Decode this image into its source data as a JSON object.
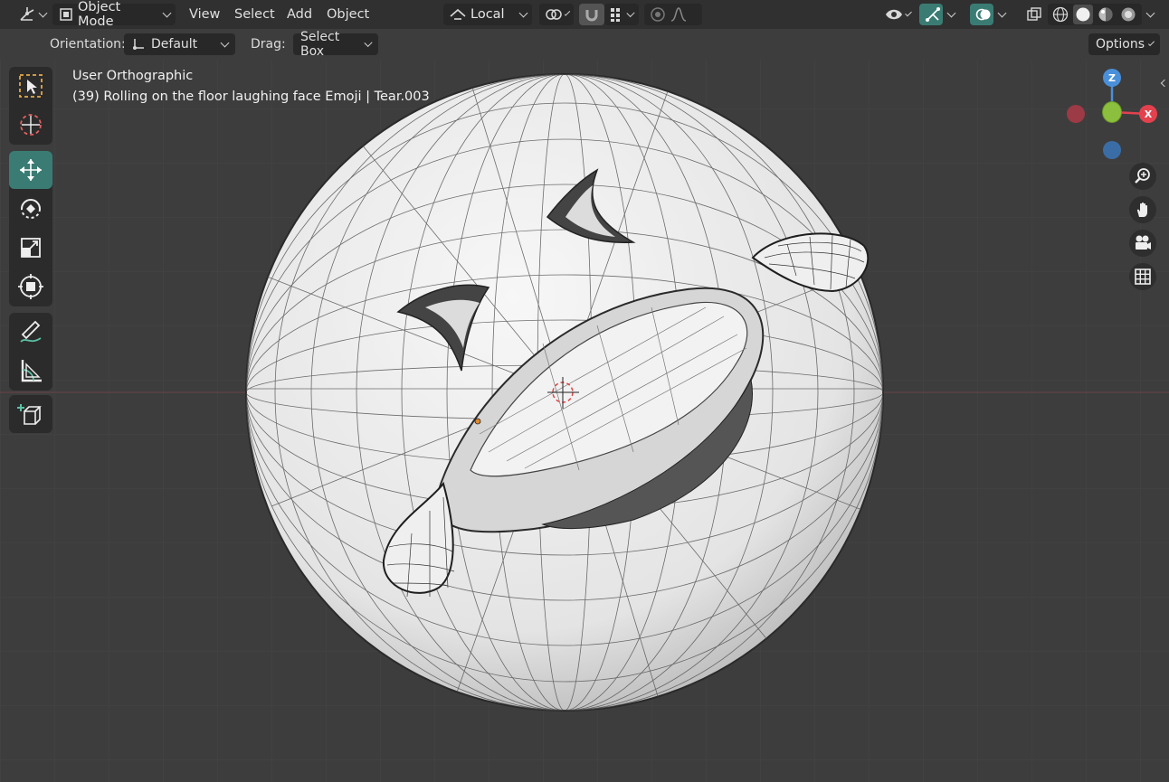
{
  "header": {
    "editor_type_icon": "axes-icon",
    "mode": "Object Mode",
    "menus": [
      "View",
      "Select",
      "Add",
      "Object"
    ],
    "transform_orientation": "Local",
    "pivot_icon": "pivot-icon",
    "snap_icon": "magnet-icon",
    "snap_target_icon": "grid-snap-icon",
    "proportional_icon": "proportional-edit-icon",
    "falloff_icon": "falloff-curve-icon",
    "visibility_icon": "eye-icon",
    "gizmo_icon": "gizmo-icon",
    "overlay_icon": "overlay-icon",
    "xray_icon": "xray-icon",
    "shading_modes": [
      "wireframe-icon",
      "solid-icon",
      "material-icon",
      "rendered-icon"
    ],
    "accent": "#3a7c73"
  },
  "tool_settings": {
    "orientation_label": "Orientation:",
    "orientation_value": "Default",
    "drag_label": "Drag:",
    "drag_value": "Select Box",
    "options_label": "Options"
  },
  "toolbar": {
    "tools": [
      {
        "name": "select-box-icon"
      },
      {
        "name": "cursor-icon"
      },
      {
        "name": "move-icon",
        "active": true
      },
      {
        "name": "rotate-icon"
      },
      {
        "name": "scale-icon"
      },
      {
        "name": "transform-icon"
      },
      {
        "name": "annotate-icon"
      },
      {
        "name": "measure-icon"
      },
      {
        "name": "add-cube-icon"
      }
    ]
  },
  "viewport": {
    "view_name": "User Orthographic",
    "object_info": "(39) Rolling on the floor laughing face Emoji | Tear.003",
    "background": "#3d3d3d",
    "mesh_color": "#e8e8e8"
  },
  "navigation": {
    "gizmo_axes": {
      "z": "Z",
      "x": "X"
    },
    "axis_colors": {
      "x": "#e3414e",
      "y": "#8cbf3d",
      "z": "#4a8fd9"
    },
    "buttons": [
      "zoom-icon",
      "pan-hand-icon",
      "camera-icon",
      "grid-icon"
    ]
  }
}
